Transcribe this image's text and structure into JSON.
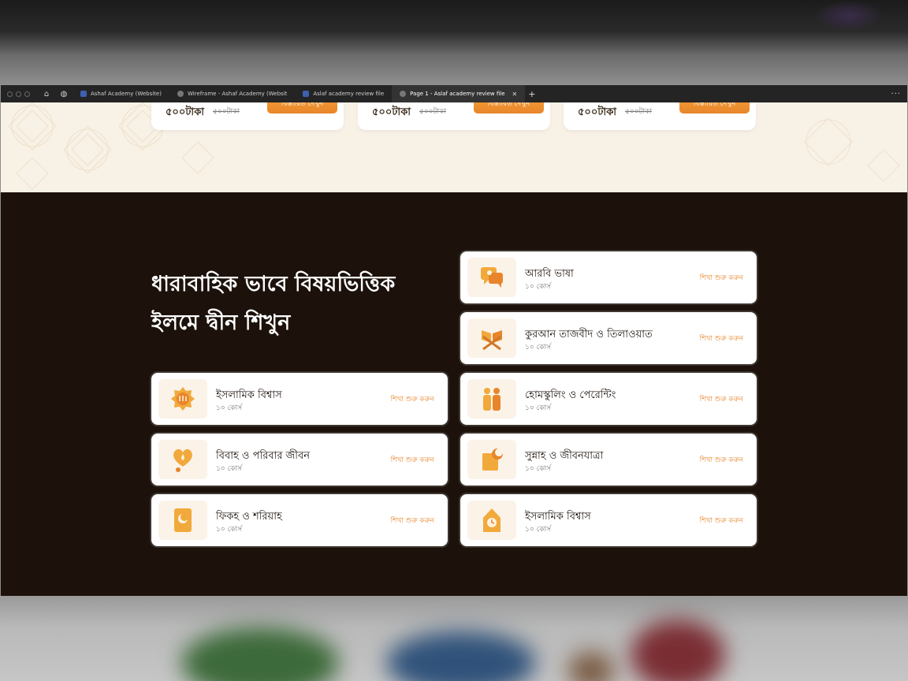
{
  "browser": {
    "tabs": [
      {
        "label": "Ashaf Academy (Website)",
        "active": false
      },
      {
        "label": "Wireframe - Ashaf Academy (Websit",
        "active": false
      },
      {
        "label": "Aslaf academy review file",
        "active": false
      },
      {
        "label": "Page 1 - Aslaf academy review file",
        "active": true
      }
    ],
    "close_glyph": "✕",
    "new_tab_glyph": "+",
    "menu_glyph": "···"
  },
  "pricing": {
    "cards": [
      {
        "price": "৫০০টাকা",
        "old_price": "৫০০টাকা",
        "button": "বিস্তারিত দেখুন"
      },
      {
        "price": "৫০০টাকা",
        "old_price": "৫০০টাকা",
        "button": "বিস্তারিত দেখুন"
      },
      {
        "price": "৫০০টাকা",
        "old_price": "৫০০টাকা",
        "button": "বিস্তারিত দেখুন"
      }
    ]
  },
  "section": {
    "heading_line1": "ধারাবাহিক ভাবে বিষয়ভিত্তিক",
    "heading_line2": "ইলমে দ্বীন শিখুন"
  },
  "topics": [
    {
      "title": "আরবি ভাষা",
      "count": "১০ কোর্স",
      "cta": "শিখা শুরু করুন",
      "icon": "chat-bubbles-icon"
    },
    {
      "title": "কুরআন তাজবীদ ও তিলাওয়াত",
      "count": "১০ কোর্স",
      "cta": "শিখা শুরু করুন",
      "icon": "quran-stand-icon"
    },
    {
      "title": "ইসলামিক বিশ্বাস",
      "count": "১০ কোর্স",
      "cta": "শিখা শুরু করুন",
      "icon": "allah-emblem-icon"
    },
    {
      "title": "হোমস্কুলিং ও পেরেন্টিং",
      "count": "১০ কোর্স",
      "cta": "শিখা শুরু করুন",
      "icon": "family-icon"
    },
    {
      "title": "বিবাহ ও পরিবার জীবন",
      "count": "১০ কোর্স",
      "cta": "শিখা শুরু করুন",
      "icon": "heart-drop-icon"
    },
    {
      "title": "সুন্নাহ ও জীবনযাত্রা",
      "count": "১০ কোর্স",
      "cta": "শিখা শুরু করুন",
      "icon": "book-moon-icon"
    },
    {
      "title": "ফিকহ ও শরিয়াহ",
      "count": "১০ কোর্স",
      "cta": "শিখা শুরু করুন",
      "icon": "crescent-book-icon"
    },
    {
      "title": "ইসলামিক বিশ্বাস",
      "count": "১০ কোর্স",
      "cta": "শিখা শুরু করুন",
      "icon": "mosque-clock-icon"
    }
  ],
  "colors": {
    "accent": "#e8852b",
    "dark_bg": "#1c120b",
    "cream_bg": "#f8f1e6",
    "icon_gold": "#f2a93b"
  }
}
